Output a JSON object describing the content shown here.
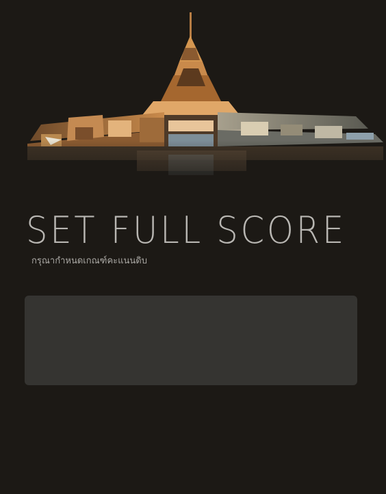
{
  "header": {
    "banner": {
      "icon": "temple-building-icon"
    }
  },
  "main": {
    "title": "SET FULL SCORE",
    "subtitle": "กรุณากำหนดเกณฑ์คะแนนดิบ"
  },
  "colors": {
    "background": "#1c1915",
    "panel": "#353431",
    "title_text": "#b8b6b2",
    "temple_gold": "#c9884a"
  }
}
